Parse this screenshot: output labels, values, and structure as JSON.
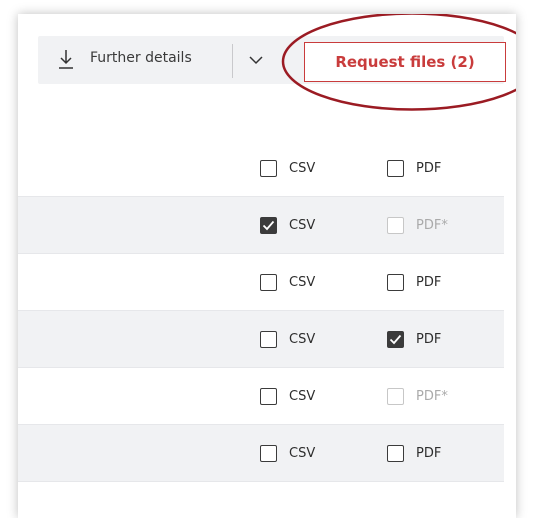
{
  "toolbar": {
    "details_label": "Further details",
    "request_label": "Request files (2)",
    "accent_color": "#c93c3c"
  },
  "rows": [
    {
      "csv": {
        "label": "CSV",
        "checked": false,
        "disabled": false
      },
      "pdf": {
        "label": "PDF",
        "checked": false,
        "disabled": false
      }
    },
    {
      "csv": {
        "label": "CSV",
        "checked": true,
        "disabled": false
      },
      "pdf": {
        "label": "PDF*",
        "checked": false,
        "disabled": true
      }
    },
    {
      "csv": {
        "label": "CSV",
        "checked": false,
        "disabled": false
      },
      "pdf": {
        "label": "PDF",
        "checked": false,
        "disabled": false
      }
    },
    {
      "csv": {
        "label": "CSV",
        "checked": false,
        "disabled": false
      },
      "pdf": {
        "label": "PDF",
        "checked": true,
        "disabled": false
      }
    },
    {
      "csv": {
        "label": "CSV",
        "checked": false,
        "disabled": false
      },
      "pdf": {
        "label": "PDF*",
        "checked": false,
        "disabled": true
      }
    },
    {
      "csv": {
        "label": "CSV",
        "checked": false,
        "disabled": false
      },
      "pdf": {
        "label": "PDF",
        "checked": false,
        "disabled": false
      }
    }
  ],
  "icons": {
    "details": "download-icon",
    "dropdown": "chevron-down-icon",
    "checked": "checkmark-icon"
  }
}
